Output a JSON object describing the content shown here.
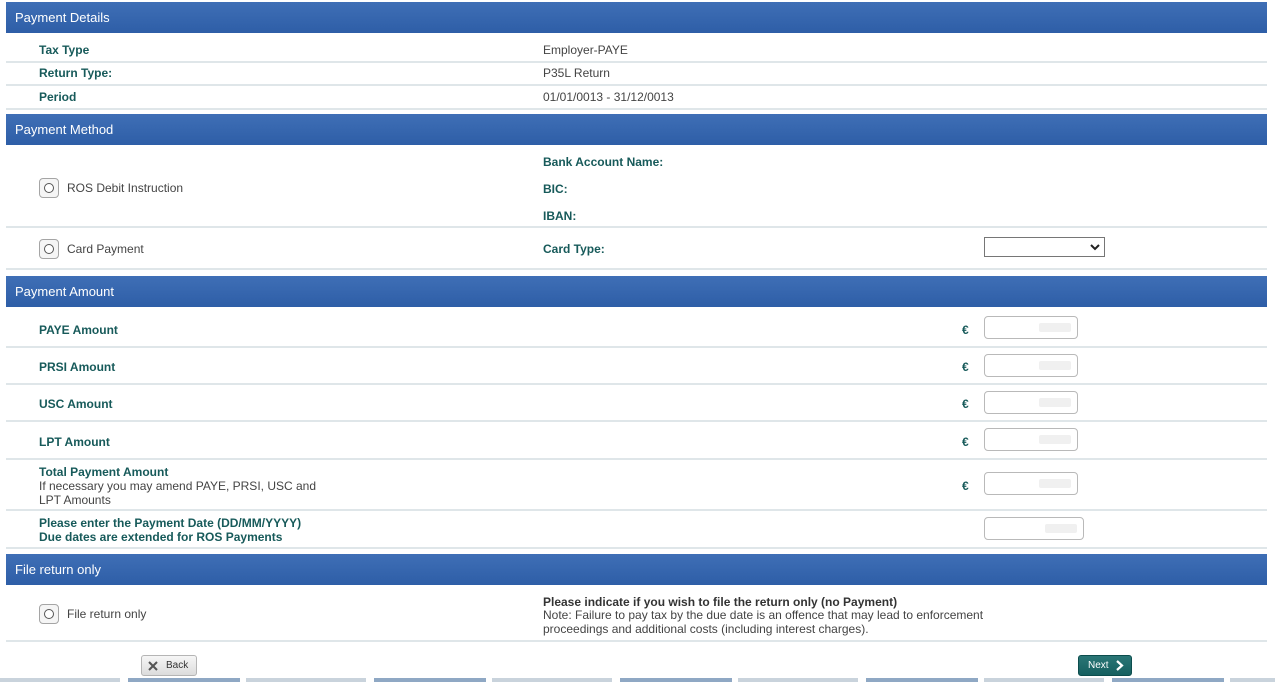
{
  "payment_details": {
    "header": "Payment Details",
    "rows": [
      {
        "label": "Tax Type",
        "value": "Employer-PAYE"
      },
      {
        "label": "Return Type:",
        "value": "P35L Return"
      },
      {
        "label": "Period",
        "value": "01/01/0013 - 31/12/0013"
      }
    ]
  },
  "payment_method": {
    "header": "Payment Method",
    "ros_debit": {
      "label": "ROS Debit Instruction",
      "bank_account_name_label": "Bank Account Name:",
      "bic_label": "BIC:",
      "iban_label": "IBAN:"
    },
    "card_payment": {
      "label": "Card Payment",
      "card_type_label": "Card Type:",
      "card_type_value": ""
    }
  },
  "payment_amount": {
    "header": "Payment Amount",
    "currency_symbol": "€",
    "paye_label": "PAYE Amount",
    "prsi_label": "PRSI Amount",
    "usc_label": "USC Amount",
    "lpt_label": "LPT Amount",
    "total_label": "Total Payment Amount",
    "total_note_line1": "If necessary you may amend PAYE, PRSI, USC and",
    "total_note_line2": "LPT Amounts",
    "date_label_line1": "Please enter the Payment Date (DD/MM/YYYY)",
    "date_label_line2": "Due dates are extended for ROS Payments"
  },
  "file_return": {
    "header": "File return only",
    "option_label": "File return only",
    "notice_title": "Please indicate if you wish to file the return only (no Payment)",
    "notice_line1": "Note: Failure to pay tax by the due date is an offence that may lead to enforcement",
    "notice_line2": "proceedings and additional costs (including interest charges)."
  },
  "buttons": {
    "back_label": "Back",
    "next_label": "Next"
  },
  "colors": {
    "header_blue": "#3a68b0",
    "label_teal": "#175a5a",
    "next_button": "#1f6b6b"
  },
  "icons": {
    "back": "close-x-icon",
    "next": "chevron-right-icon",
    "select": "chevron-down-icon"
  }
}
